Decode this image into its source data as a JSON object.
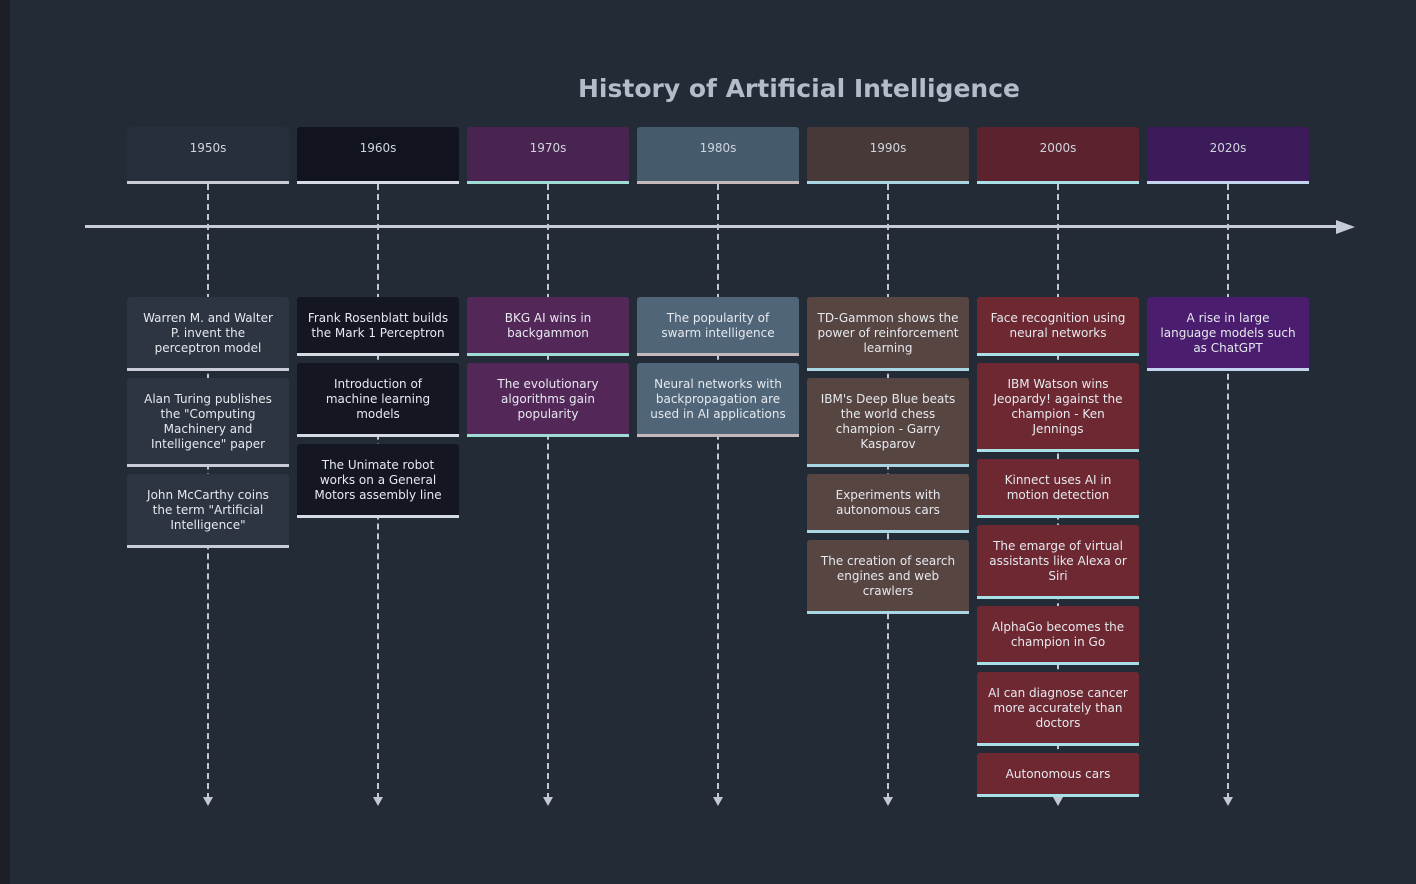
{
  "title": "History of Artificial Intelligence",
  "sections": [
    {
      "period": "1950s",
      "header_color": "#262f3b",
      "event_color": "#2c3541",
      "line_color": "#c8ccd6",
      "events": [
        "Warren M. and Walter P. invent the perceptron model",
        "Alan Turing publishes the \"Computing Machinery and Intelligence\" paper",
        "John McCarthy coins the term \"Artificial Intelligence\""
      ]
    },
    {
      "period": "1960s",
      "header_color": "#11131e",
      "event_color": "#141622",
      "line_color": "#d6dae2",
      "events": [
        "Frank Rosenblatt builds the Mark 1 Perceptron",
        "Introduction of machine learning models",
        "The Unimate robot works on a General Motors assembly line"
      ]
    },
    {
      "period": "1970s",
      "header_color": "#4a2450",
      "event_color": "#532858",
      "line_color": "#9fdcd3",
      "events": [
        "BKG AI wins in backgammon",
        "The evolutionary algorithms gain popularity"
      ]
    },
    {
      "period": "1980s",
      "header_color": "#455a6b",
      "event_color": "#506678",
      "line_color": "#c4b8bc",
      "events": [
        "The popularity of swarm intelligence",
        "Neural networks with backpropagation are used in AI applications"
      ]
    },
    {
      "period": "1990s",
      "header_color": "#473938",
      "event_color": "#574542",
      "line_color": "#a9d6e2",
      "events": [
        "TD-Gammon shows the power of reinforcement learning",
        "IBM's Deep Blue beats the world chess champion - Garry Kasparov",
        "Experiments with autonomous cars",
        "The creation of search engines and web crawlers"
      ]
    },
    {
      "period": "2000s",
      "header_color": "#5c232e",
      "event_color": "#6e2831",
      "line_color": "#a9dfe6",
      "events": [
        "Face recognition using neural networks",
        "IBM Watson wins Jeopardy! against the champion - Ken Jennings",
        "Kinnect uses AI in motion detection",
        "The emarge of virtual assistants like Alexa or Siri",
        "AlphaGo becomes the champion in Go",
        "AI can diagnose cancer more accurately than doctors",
        "Autonomous cars"
      ]
    },
    {
      "period": "2020s",
      "header_color": "#3d1b5b",
      "event_color": "#4a1d6e",
      "line_color": "#c4d4ee",
      "events": [
        "A rise in large language models such as ChatGPT"
      ]
    }
  ]
}
